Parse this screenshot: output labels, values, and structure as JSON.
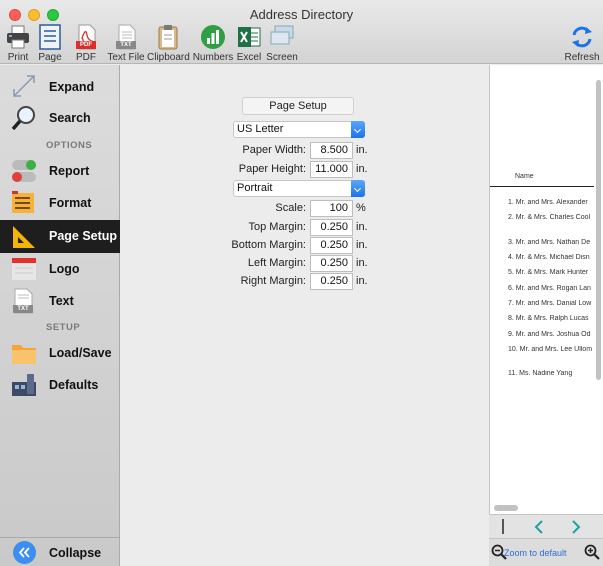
{
  "window": {
    "title": "Address Directory"
  },
  "toolbar": {
    "items": [
      {
        "label": "Print",
        "icon": "printer-icon"
      },
      {
        "label": "Page",
        "icon": "page-icon"
      },
      {
        "label": "PDF",
        "icon": "pdf-icon"
      },
      {
        "label": "Text File",
        "icon": "text-file-icon"
      },
      {
        "label": "Clipboard",
        "icon": "clipboard-icon"
      },
      {
        "label": "Numbers",
        "icon": "numbers-icon"
      },
      {
        "label": "Excel",
        "icon": "excel-icon"
      },
      {
        "label": "Screen",
        "icon": "screen-icon"
      }
    ],
    "refresh": {
      "label": "Refresh",
      "icon": "refresh-icon"
    },
    "pdf_badge": "PDF",
    "txt_badge": "TXT"
  },
  "sidebar": {
    "expand": "Expand",
    "search": "Search",
    "options_header": "OPTIONS",
    "report": "Report",
    "format": "Format",
    "page_setup": "Page Setup",
    "logo": "Logo",
    "text": "Text",
    "setup_header": "SETUP",
    "load_save": "Load/Save",
    "defaults": "Defaults",
    "collapse": "Collapse",
    "txt_badge": "TXT"
  },
  "page_setup": {
    "title": "Page Setup",
    "paper_size": "US Letter",
    "paper_width_label": "Paper Width:",
    "paper_width": "8.500",
    "paper_height_label": "Paper Height:",
    "paper_height": "11.000",
    "orientation": "Portrait",
    "scale_label": "Scale:",
    "scale": "100",
    "scale_unit": "%",
    "top_margin_label": "Top Margin:",
    "top_margin": "0.250",
    "bottom_margin_label": "Bottom Margin:",
    "bottom_margin": "0.250",
    "left_margin_label": "Left Margin:",
    "left_margin": "0.250",
    "right_margin_label": "Right Margin:",
    "right_margin": "0.250",
    "unit": "in."
  },
  "preview": {
    "column_header": "Name",
    "rows": [
      "1. Mr. and Mrs. Alexander",
      "2. Mr. & Mrs. Charles Cool",
      "3. Mr. and Mrs. Nathan De",
      "4. Mr. & Mrs. Michael Disn",
      "5. Mr. & Mrs. Mark Hunter",
      "6. Mr. and Mrs. Rogan Lan",
      "7. Mr. and Mrs. Danial Low",
      "8. Mr. & Mrs. Ralph Lucas",
      "9. Mr. and Mrs. Joshua Od",
      "10. Mr. and Mrs. Lee Ullom",
      "11. Ms. Nadine Yang"
    ],
    "zoom_label": "Zoom to default"
  },
  "colors": {
    "accent": "#1a73e8",
    "active_nav": "#1e1e1e",
    "zoom_link": "#2a6fd6"
  }
}
